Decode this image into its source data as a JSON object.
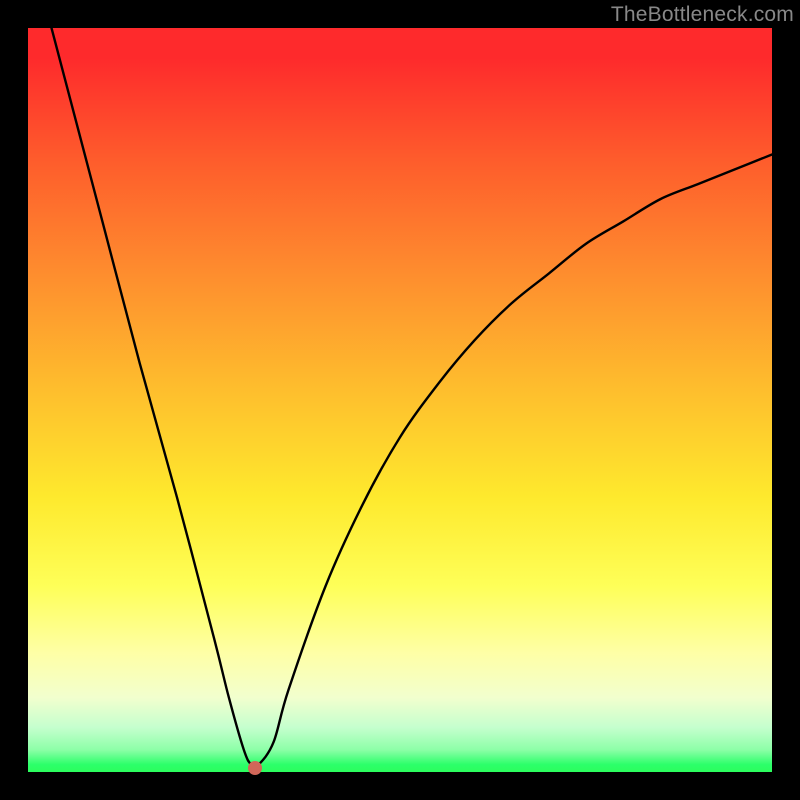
{
  "watermark": "TheBottleneck.com",
  "colors": {
    "frame": "#000000",
    "curve": "#000000",
    "dot": "#d16759"
  },
  "chart_data": {
    "type": "line",
    "title": "",
    "xlabel": "",
    "ylabel": "",
    "xlim": [
      0,
      100
    ],
    "ylim": [
      0,
      100
    ],
    "grid": false,
    "series": [
      {
        "name": "curve",
        "x": [
          0,
          5,
          10,
          15,
          20,
          25,
          27,
          29,
          30,
          31,
          33,
          35,
          40,
          45,
          50,
          55,
          60,
          65,
          70,
          75,
          80,
          85,
          90,
          95,
          100
        ],
        "y": [
          112,
          93,
          74,
          55,
          37,
          18,
          10,
          3,
          1,
          1,
          4,
          11,
          25,
          36,
          45,
          52,
          58,
          63,
          67,
          71,
          74,
          77,
          79,
          81,
          83
        ]
      }
    ],
    "marker": {
      "x": 30.5,
      "y": 0.5
    },
    "annotations": [
      {
        "text": "TheBottleneck.com",
        "position": "top-right"
      }
    ]
  }
}
